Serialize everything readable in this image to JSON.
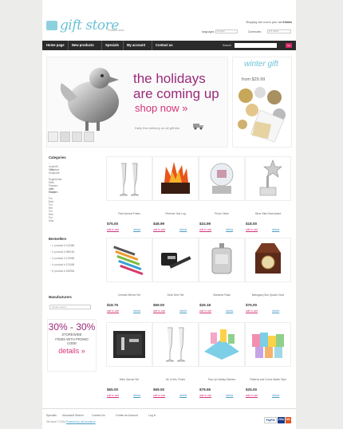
{
  "header": {
    "logo_text": "gift store",
    "tagline": "Products store",
    "cart": {
      "prefix": "Shopping cart:",
      "text": "now in your cart",
      "count": "0 items"
    },
    "languages_label": "languages:",
    "languages_value": "English",
    "currencies_label": "Currencies:",
    "currencies_value": "US dollar"
  },
  "nav": {
    "items": [
      "Home page",
      "New products",
      "Specials",
      "My account",
      "Contact us"
    ],
    "search_label": "Search",
    "search_button": "Go"
  },
  "banner": {
    "headline_1": "the holidays",
    "headline_2": "are coming up",
    "cta": "shop now »",
    "delivery": "Daily free delivery on all gift kits"
  },
  "side_banner": {
    "title": "winter gift",
    "price": "from $29.99"
  },
  "sidebar": {
    "categories_title": "Categories",
    "categories": [
      "Audio/Hi Gifts",
      "Outdoor Hotsports",
      "Engineered Gifts",
      "Flowers and Plants",
      "For Couples",
      "For Dad",
      "For Her",
      "For Him",
      "For Kids"
    ],
    "bestsellers_title": "Bestsellers",
    "bestsellers": [
      "1. product # 123456",
      "2. product # 986163",
      "3. product # 123656",
      "4. product # 123456",
      "5. product # 256954"
    ],
    "manufacturers_title": "Manufacturers",
    "manufacturers_select": "Please Select",
    "promo": {
      "percent": "30% - 30%",
      "line1": "STOREWIDE",
      "line2": "ITEMS WITH PROMO",
      "line3": "CODE",
      "more": "details »"
    }
  },
  "products": [
    {
      "name": "Park Avenue Flutes",
      "price": "$75.00"
    },
    {
      "name": "Perfume Yule Log",
      "price": "$48.99"
    },
    {
      "name": "Photo Globe",
      "price": "$24.99"
    },
    {
      "name": "Silver Star Desk Award",
      "price": "$18.00"
    },
    {
      "name": "Cerrado Wiener Set",
      "price": "$18.75"
    },
    {
      "name": "Deck Deer Set",
      "price": "$59.00"
    },
    {
      "name": "Stainless Flask",
      "price": "$29.18"
    },
    {
      "name": "Mahogany Box Quartz Clock",
      "price": "$75.00"
    },
    {
      "name": "Wine Opener Set",
      "price": "$65.00"
    },
    {
      "name": "Mr. & Mrs. Flutes",
      "price": "$69.00"
    },
    {
      "name": "Pop-Up Holiday Stickers",
      "price": "$79.95"
    },
    {
      "name": "Patterns and Colors Washi Tape",
      "price": "$25.00"
    }
  ],
  "product_actions": {
    "add": "add to cart",
    "details": "details"
  },
  "footer": {
    "links": [
      "Specials",
      "Advanced Search",
      "Contact Us",
      "Create an Account",
      "Log In"
    ],
    "copyright": "Gift store © 2014",
    "powered": "Powered by osCommerce",
    "payments": [
      "PayPal",
      "VISA",
      "MC"
    ]
  },
  "colors": {
    "accent": "#d02867",
    "purple": "#9a2a7a",
    "teal": "#6cc3d6",
    "nav": "#2b2b2b"
  }
}
